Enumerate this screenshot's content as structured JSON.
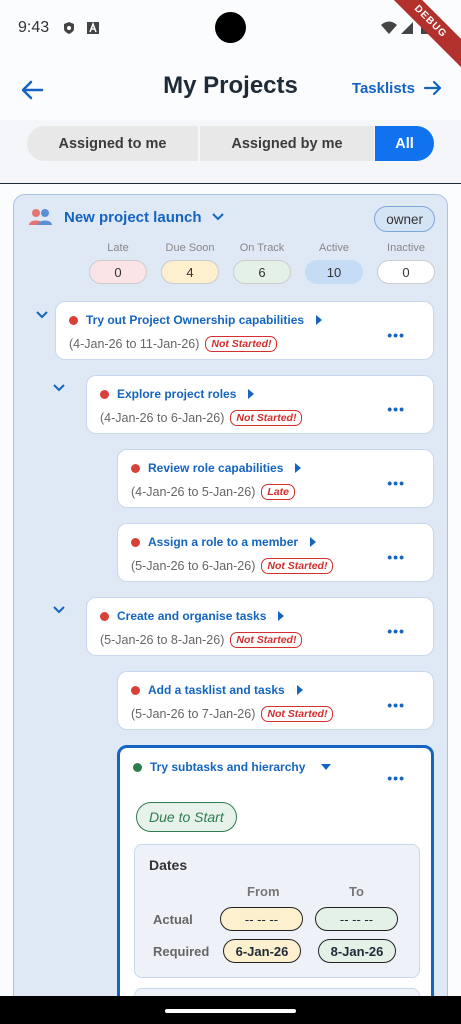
{
  "status_bar": {
    "time": "9:43",
    "debug": "DEBUG"
  },
  "header": {
    "title": "My Projects",
    "tasklists_label": "Tasklists"
  },
  "filters": {
    "assigned_to_me": "Assigned to me",
    "assigned_by_me": "Assigned by me",
    "all": "All",
    "selected": "All"
  },
  "project": {
    "title": "New project launch",
    "role": "owner",
    "stats": [
      {
        "label": "Late",
        "value": "0",
        "color": "#fbe4e6"
      },
      {
        "label": "Due Soon",
        "value": "4",
        "color": "#fdf0cf"
      },
      {
        "label": "On Track",
        "value": "6",
        "color": "#e3f1e7"
      },
      {
        "label": "Active",
        "value": "10",
        "color": "#c5dbf6"
      },
      {
        "label": "Inactive",
        "value": "0",
        "color": "#ffffff"
      }
    ]
  },
  "tasks": [
    {
      "name": "Try out Project Ownership capabilities",
      "dates": "(4-Jan-26 to 11-Jan-26)",
      "status": "Not Started!"
    },
    {
      "name": "Explore project roles",
      "dates": "(4-Jan-26 to 6-Jan-26)",
      "status": "Not Started!"
    },
    {
      "name": "Review role capabilities",
      "dates": "(4-Jan-26 to 5-Jan-26)",
      "status": "Late"
    },
    {
      "name": "Assign a role to a member",
      "dates": "(5-Jan-26 to 6-Jan-26)",
      "status": "Not Started!"
    },
    {
      "name": "Create and organise tasks",
      "dates": "(5-Jan-26 to 8-Jan-26)",
      "status": "Not Started!"
    },
    {
      "name": "Add a tasklist and tasks",
      "dates": "(5-Jan-26 to 7-Jan-26)",
      "status": "Not Started!"
    }
  ],
  "expanded_task": {
    "name": "Try subtasks and hierarchy",
    "status_pill": "Due to Start",
    "dates": {
      "title": "Dates",
      "from_header": "From",
      "to_header": "To",
      "actual_label": "Actual",
      "required_label": "Required",
      "actual_from": "-- -- --",
      "actual_to": "-- -- --",
      "required_from": "6-Jan-26",
      "required_to": "8-Jan-26"
    }
  },
  "icons": {
    "back": "arrow-left-icon",
    "forward": "arrow-right-icon",
    "group": "people-group-icon",
    "more": "more-horizontal-icon"
  }
}
